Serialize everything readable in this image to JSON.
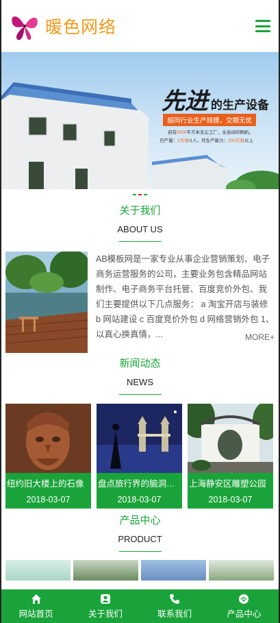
{
  "header": {
    "logo_text": "暖色网络",
    "logo_icon": "butterfly-icon",
    "menu_icon": "hamburger-menu-icon"
  },
  "banner": {
    "headline_big": "先进",
    "headline_rest": "的生产设备",
    "tag": "超同行业生产规模，交期无忧",
    "line1_pre": "自有",
    "line1_num": "5000",
    "line1_post": "平方米无尘工厂，全自动印刷机，",
    "line2_pre": "日产量：",
    "line2_num1": "2万张",
    "line2_mid": "/1人，月生产能力：",
    "line2_num2": "200万张",
    "line2_post": "以上",
    "slide_count": 3,
    "active_slide": 2
  },
  "about": {
    "title_cn": "关于我们",
    "title_en": "ABOUT US",
    "text": "AB模板网是一家专业从事企业营销策划、电子商务运营服务的公司，主要业务包含精品网站制作、电子商务平台托管、百度竞价外包、我们主要提供以下几点服务： a 淘宝开店与装修 b 网站建设 c 百度竞价外包 d 网络营销外包 1、以真心换真情，...",
    "more": "MORE+"
  },
  "news": {
    "title_cn": "新闻动态",
    "title_en": "NEWS",
    "items": [
      {
        "title": "纽约旧大楼上的石像",
        "date": "2018-03-07"
      },
      {
        "title": "盘点旅行界的脑洞大开",
        "date": "2018-03-07"
      },
      {
        "title": "上海静安区雕塑公园",
        "date": "2018-03-07"
      }
    ]
  },
  "products": {
    "title_cn": "产品中心",
    "title_en": "PRODUCT"
  },
  "bottom_nav": [
    {
      "label": "网站首页",
      "icon": "home-icon"
    },
    {
      "label": "关于我们",
      "icon": "user-icon"
    },
    {
      "label": "联系我们",
      "icon": "phone-icon"
    },
    {
      "label": "产品中心",
      "icon": "product-icon"
    }
  ],
  "colors": {
    "brand_green": "#1aa33a",
    "logo_orange": "#f09a1a",
    "accent_orange": "#e8601c"
  }
}
